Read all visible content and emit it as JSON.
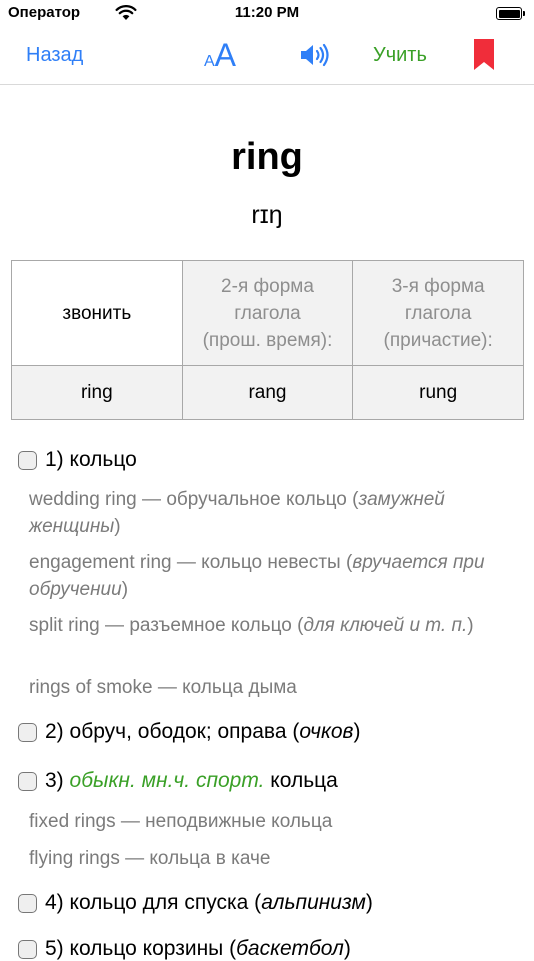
{
  "status": {
    "carrier": "Оператор",
    "time": "11:20 PM"
  },
  "nav": {
    "back": "Назад",
    "font_small": "A",
    "font_big": "A",
    "learn": "Учить",
    "speaker_icon": "speaker-icon",
    "bookmark_icon": "bookmark-icon",
    "accent": "#2f7ff7",
    "learn_color": "#3aa027",
    "bookmark_color": "#f02d3a"
  },
  "entry": {
    "word": "ring",
    "transcription": "rɪŋ"
  },
  "forms": {
    "translation": "звонить",
    "header2": [
      "2-я форма",
      "глагола",
      "(прош. время):"
    ],
    "header3": [
      "3-я форма",
      "глагола",
      "(причастие):"
    ],
    "values": [
      "ring",
      "rang",
      "rung"
    ]
  },
  "meanings": [
    {
      "num": "1)",
      "text": "кольцо",
      "examples": [
        {
          "phrase": "wedding ring",
          "dash": " — ",
          "translation": "обручальное кольцо",
          "note_open": " (",
          "note": "замужней женщины",
          "note_close": ")"
        },
        {
          "phrase": "engagement ring",
          "dash": " — ",
          "translation": "кольцо невесты",
          "note_open": " (",
          "note": "вручается при обручении",
          "note_close": ")"
        },
        {
          "phrase": "split ring",
          "dash": " — ",
          "translation": "разъемное кольцо",
          "note_open": " (",
          "note": "для ключей и т. п.",
          "note_close": ")"
        },
        {
          "phrase": "rings of smoke",
          "dash": " — ",
          "translation": "кольца дыма"
        }
      ]
    },
    {
      "num": "2)",
      "text": "обруч, ободок; оправа (",
      "note": "очков",
      "close": ")"
    },
    {
      "num": "3)",
      "label": "обыкн. мн.ч. спорт.",
      "text": "кольца",
      "examples": [
        {
          "phrase": "fixed rings",
          "dash": " — ",
          "translation": "неподвижные кольца"
        },
        {
          "phrase": "flying rings",
          "dash": " — ",
          "translation": "кольца в каче"
        }
      ]
    },
    {
      "num": "4)",
      "text": "кольцо для спуска (",
      "note": "альпинизм",
      "close": ")"
    },
    {
      "num": "5)",
      "text": "кольцо корзины (",
      "note": "баскетбол",
      "close": ")"
    }
  ]
}
